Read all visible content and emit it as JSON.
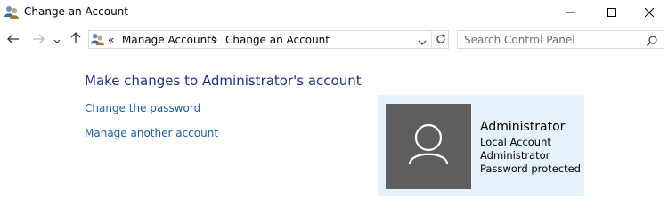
{
  "window": {
    "title": "Change an Account",
    "icons": {
      "app": "users-control-panel-icon",
      "minimize": "minimize-icon",
      "maximize": "maximize-icon",
      "close": "close-icon"
    }
  },
  "navigation": {
    "icons": {
      "back": "arrow-left-icon",
      "forward": "arrow-right-icon",
      "recent": "chevron-down-icon",
      "up": "arrow-up-icon"
    },
    "address": {
      "overflow": "«",
      "crumbs": [
        "Manage Accounts",
        "Change an Account"
      ],
      "icons": {
        "location": "users-control-panel-icon",
        "separator": "chevron-right-icon",
        "dropdown": "chevron-down-icon",
        "refresh": "refresh-icon"
      }
    },
    "search": {
      "placeholder": "Search Control Panel",
      "icon": "search-icon"
    }
  },
  "main": {
    "heading": "Make changes to Administrator's account",
    "links": [
      "Change the password",
      "Manage another account"
    ]
  },
  "account": {
    "name": "Administrator",
    "details": [
      "Local Account",
      "Administrator",
      "Password protected"
    ],
    "icon": "user-avatar-icon",
    "colors": {
      "panel": "#e5f1fb",
      "tile": "#5e5e5e"
    }
  },
  "colors": {
    "heading": "#1e3287",
    "link": "#1a5ea8"
  }
}
